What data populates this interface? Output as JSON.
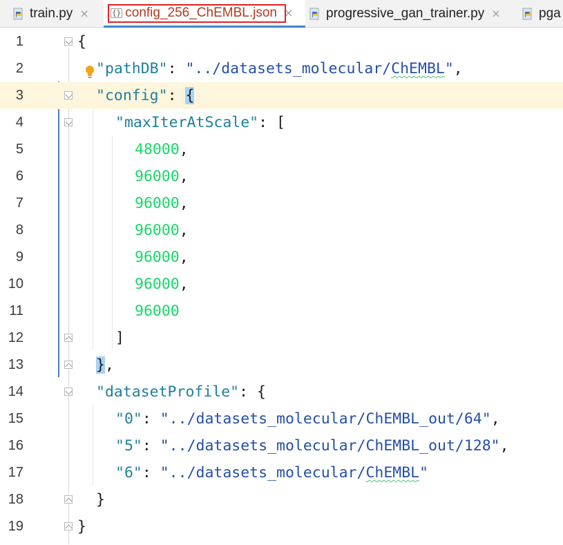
{
  "tabs": [
    {
      "label": "train.py",
      "icon": "python-file-icon",
      "active": false
    },
    {
      "label": "config_256_ChEMBL.json",
      "icon": "json-file-icon",
      "active": true
    },
    {
      "label": "progressive_gan_trainer.py",
      "icon": "python-file-icon",
      "active": false
    },
    {
      "label": "pga",
      "icon": "python-file-icon",
      "active": false
    }
  ],
  "tab_close_glyph": "×",
  "json_icon_glyph": "{}",
  "current_line": 3,
  "lines": [
    {
      "n": "1"
    },
    {
      "n": "2"
    },
    {
      "n": "3"
    },
    {
      "n": "4"
    },
    {
      "n": "5"
    },
    {
      "n": "6"
    },
    {
      "n": "7"
    },
    {
      "n": "8"
    },
    {
      "n": "9"
    },
    {
      "n": "10"
    },
    {
      "n": "11"
    },
    {
      "n": "12"
    },
    {
      "n": "13"
    },
    {
      "n": "14"
    },
    {
      "n": "15"
    },
    {
      "n": "16"
    },
    {
      "n": "17"
    },
    {
      "n": "18"
    },
    {
      "n": "19"
    }
  ],
  "code": {
    "open_brace": "{",
    "pathDB_key": "\"pathDB\"",
    "pathDB_value_a": "\"../datasets_molecular/",
    "pathDB_value_b": "ChEMBL",
    "pathDB_value_c": "\"",
    "config_key": "\"config\"",
    "maxIter_key": "\"maxIterAtScale\"",
    "max_iter_values": [
      "48000",
      "96000",
      "96000",
      "96000",
      "96000",
      "96000",
      "96000"
    ],
    "close_bracket": "]",
    "close_brace": "}",
    "datasetProfile_key": "\"datasetProfile\"",
    "profile": [
      {
        "key": "\"0\"",
        "value_a": "\"../datasets_molecular/",
        "value_b": "ChEMBL",
        "value_c": "_out/64\"",
        "comma": ","
      },
      {
        "key": "\"5\"",
        "value_a": "\"../datasets_molecular/",
        "value_b": "ChEMBL",
        "value_c": "_out/128\"",
        "comma": ","
      },
      {
        "key": "\"6\"",
        "value_a": "\"../datasets_molecular/",
        "value_b": "ChEMBL",
        "value_c": "\"",
        "comma": ""
      }
    ]
  },
  "colors": {
    "key": "#1f7f9e",
    "string": "#244fa8",
    "number": "#19d66a",
    "current_line": "#fdf6dc",
    "brace_match": "#a7d2f5",
    "active_tab_label": "#b03a1e"
  }
}
